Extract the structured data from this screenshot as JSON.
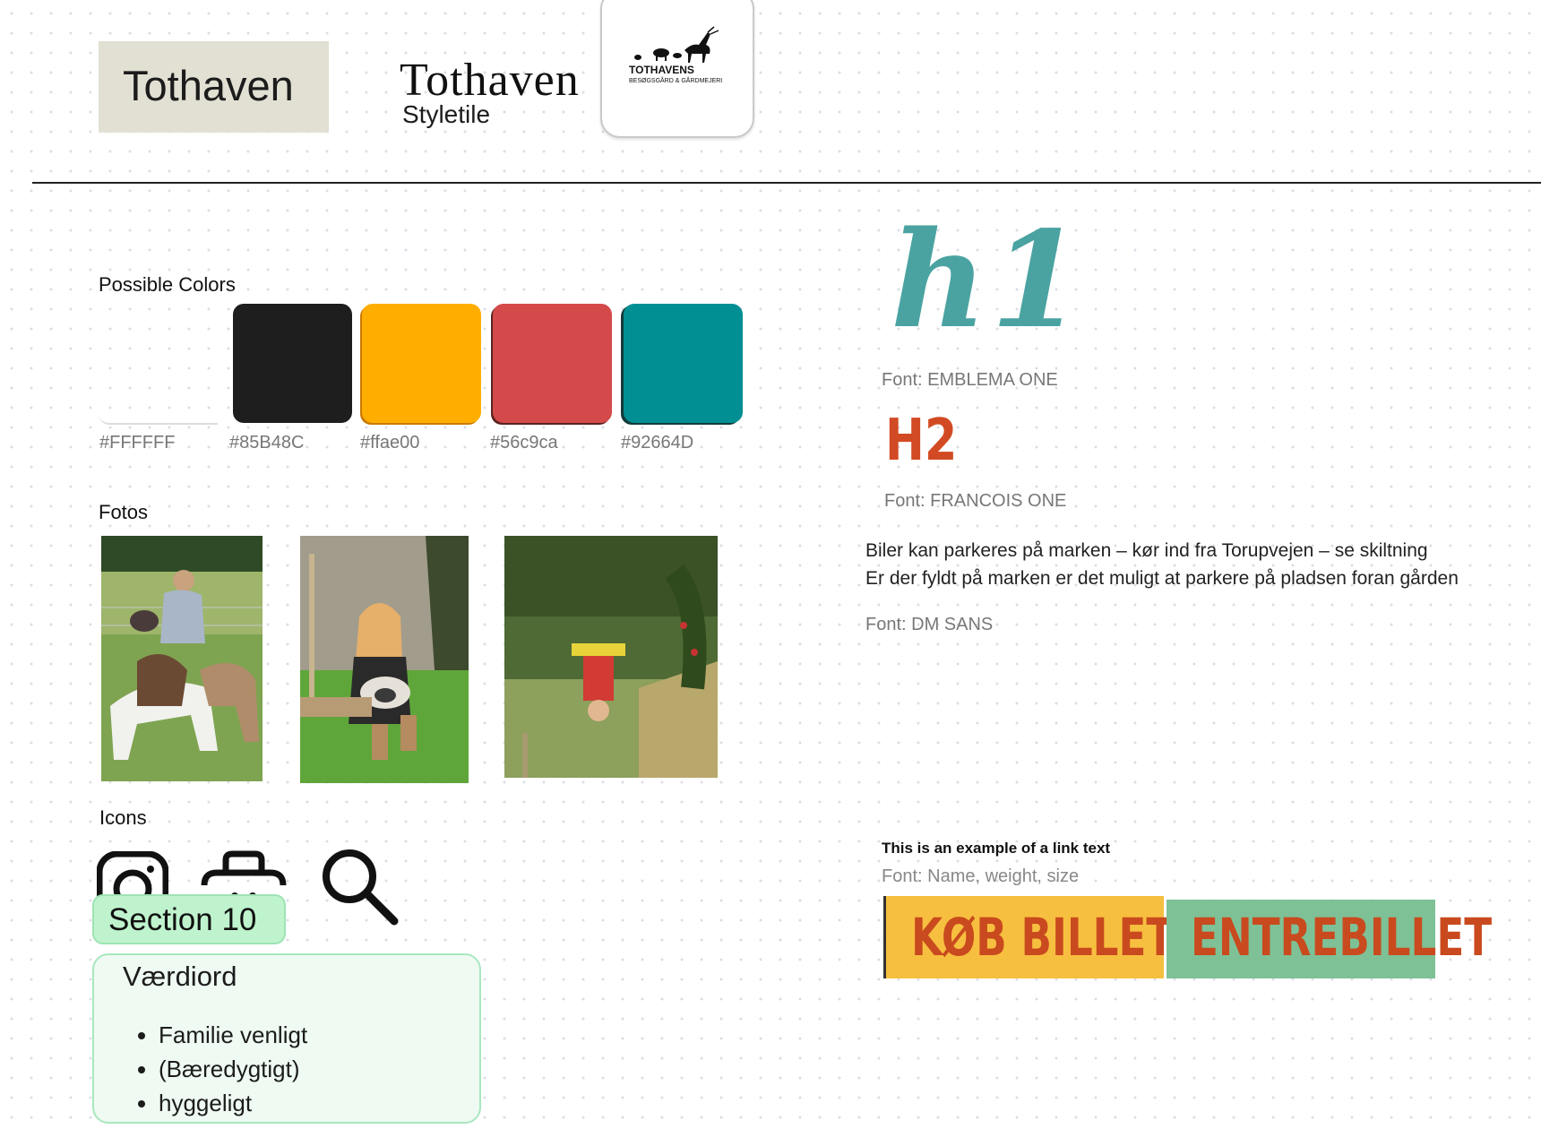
{
  "header": {
    "tile_title": "Tothaven",
    "styletile_title": "Tothaven",
    "styletile_subtitle": "Styletile",
    "logo": {
      "line1": "TOTHAVENS",
      "line2": "BESØGSGÅRD & GÅRDMEJERI"
    }
  },
  "colors": {
    "label": "Possible Colors",
    "swatches": [
      {
        "hex_label": "#FFFFFF",
        "fill": "#ffffff"
      },
      {
        "hex_label": "#85B48C",
        "fill": "#1e1e1e"
      },
      {
        "hex_label": "#ffae00",
        "fill": "#ffae00"
      },
      {
        "hex_label": "#56c9ca",
        "fill": "#d44a4a"
      },
      {
        "hex_label": "#92664D",
        "fill": "#018f93"
      }
    ]
  },
  "photos": {
    "label": "Fotos"
  },
  "icons": {
    "label": "Icons",
    "items": [
      "instagram-icon",
      "basket-icon",
      "search-icon"
    ]
  },
  "section": {
    "badge": "Section 10",
    "title": "Værdiord",
    "items": [
      "Familie venligt",
      "(Bæredygtigt)",
      "hyggeligt"
    ]
  },
  "typography": {
    "h1_sample": "h1",
    "h1_font": "Font: EMBLEMA ONE",
    "h1_color": "#4aa3a1",
    "h2_sample": "H2",
    "h2_font": "Font: FRANCOIS ONE",
    "h2_color": "#d24a23",
    "body_line_1": "Biler kan parkeres på marken – kør ind fra Torupvejen – se skiltning",
    "body_line_2": "Er der fyldt på marken er det muligt at parkere på pladsen foran gården",
    "body_font": "Font: DM SANS",
    "link_text": "This is an example of a link text",
    "link_font": "Font: Name, weight, size"
  },
  "buttons": {
    "buy": "KØB BILLET",
    "entry": "ENTREBILLET"
  }
}
